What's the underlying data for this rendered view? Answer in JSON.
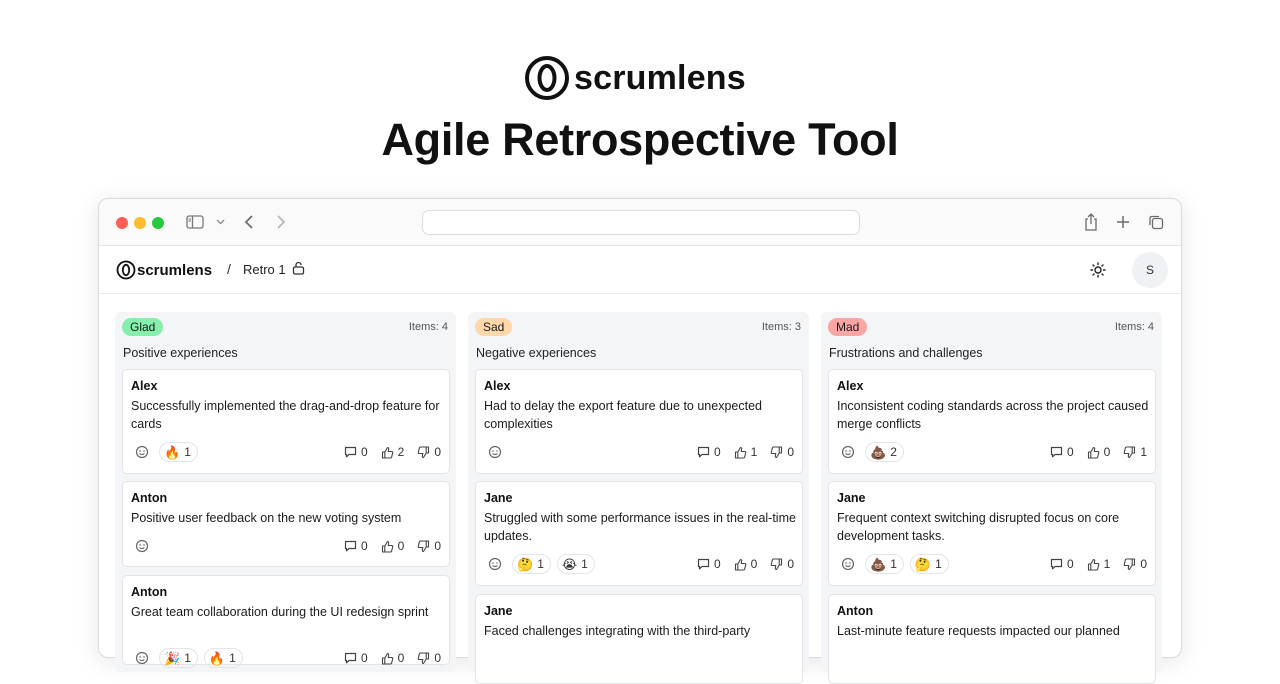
{
  "hero": {
    "brand": "scrumlens",
    "title": "Agile Retrospective Tool"
  },
  "browser": {
    "icons": [
      "sidebar-icon",
      "chevron-down-icon",
      "back-icon",
      "forward-icon",
      "share-icon",
      "plus-icon",
      "tabs-icon"
    ]
  },
  "app": {
    "brand": "scrumlens",
    "separator": "/",
    "retro_name": "Retro 1",
    "avatar_initial": "S"
  },
  "colors": {
    "glad": "#86efac",
    "sad": "#fed7aa",
    "mad": "#fca5a5",
    "column_bg": "#f4f5f7"
  },
  "columns": [
    {
      "label": "Glad",
      "items_text": "Items: 4",
      "description": "Positive experiences",
      "cards": [
        {
          "author": "Alex",
          "text": "Successfully implemented the drag-and-drop feature for cards",
          "reactions": [
            {
              "emoji": "🔥",
              "count": "1"
            }
          ],
          "comments": "0",
          "upvotes": "2",
          "downvotes": "0"
        },
        {
          "author": "Anton",
          "text": "Positive user feedback on the new voting system",
          "reactions": [],
          "comments": "0",
          "upvotes": "0",
          "downvotes": "0"
        },
        {
          "author": "Anton",
          "text": "Great team collaboration during the UI redesign sprint",
          "reactions": [
            {
              "emoji": "🎉",
              "count": "1"
            },
            {
              "emoji": "🔥",
              "count": "1"
            }
          ],
          "comments": "0",
          "upvotes": "0",
          "downvotes": "0"
        }
      ]
    },
    {
      "label": "Sad",
      "items_text": "Items: 3",
      "description": "Negative experiences",
      "cards": [
        {
          "author": "Alex",
          "text": "Had to delay the export feature due to unexpected complexities",
          "reactions": [],
          "comments": "0",
          "upvotes": "1",
          "downvotes": "0"
        },
        {
          "author": "Jane",
          "text": "Struggled with some performance issues in the real-time updates.",
          "reactions": [
            {
              "emoji": "🤔",
              "count": "1"
            },
            {
              "emoji": "😭",
              "count": "1"
            }
          ],
          "comments": "0",
          "upvotes": "0",
          "downvotes": "0"
        },
        {
          "author": "Jane",
          "text": "Faced challenges integrating with the third-party",
          "reactions": [],
          "comments": "",
          "upvotes": "",
          "downvotes": ""
        }
      ]
    },
    {
      "label": "Mad",
      "items_text": "Items: 4",
      "description": "Frustrations and challenges",
      "cards": [
        {
          "author": "Alex",
          "text": "Inconsistent coding standards across the project caused merge conflicts",
          "reactions": [
            {
              "emoji": "💩",
              "count": "2"
            }
          ],
          "comments": "0",
          "upvotes": "0",
          "downvotes": "1"
        },
        {
          "author": "Jane",
          "text": "Frequent context switching disrupted focus on core development tasks.",
          "reactions": [
            {
              "emoji": "💩",
              "count": "1"
            },
            {
              "emoji": "🤔",
              "count": "1"
            }
          ],
          "comments": "0",
          "upvotes": "1",
          "downvotes": "0"
        },
        {
          "author": "Anton",
          "text": "Last-minute feature requests impacted our planned",
          "reactions": [],
          "comments": "",
          "upvotes": "",
          "downvotes": ""
        }
      ]
    }
  ]
}
